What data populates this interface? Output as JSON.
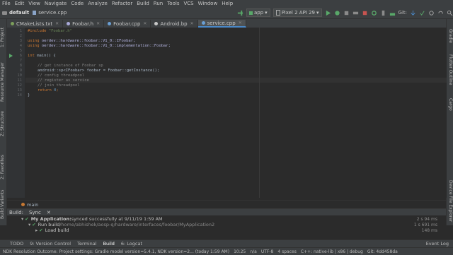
{
  "menu": [
    "File",
    "Edit",
    "View",
    "Navigate",
    "Code",
    "Analyze",
    "Refactor",
    "Build",
    "Run",
    "Tools",
    "VCS",
    "Window",
    "Help"
  ],
  "nav": {
    "project": "default",
    "file": "service.cpp",
    "run_config": "app",
    "device": "Pixel 2 API 29",
    "git_label": "Git:"
  },
  "tabs": [
    {
      "label": "CMakeLists.txt",
      "color": "#7b9e5a"
    },
    {
      "label": "Foobar.h",
      "color": "#a9a9d9"
    },
    {
      "label": "Foobar.cpp",
      "color": "#6a9fd4"
    },
    {
      "label": "Android.bp",
      "color": "#c8c8c8"
    },
    {
      "label": "service.cpp",
      "color": "#6a9fd4"
    }
  ],
  "left_tools": [
    "1: Project",
    "Resource Manager",
    "Z: Structure",
    "2: Favorites",
    "Build Variants"
  ],
  "right_tools": [
    "Gradle",
    "Flutter Outline",
    "Cargo",
    "Device File Explorer"
  ],
  "code": {
    "line_numbers": [
      "1",
      "2",
      "3",
      "4",
      "5",
      "6",
      "7",
      "8",
      "9",
      "10",
      "11",
      "12",
      "13",
      "14"
    ],
    "include_kw": "#include",
    "include_str": "\"Foobar.h\"",
    "using1": "using ",
    "using1_ns": "oerdev::hardware::foobar::V1_0::IFoobar;",
    "using2": "using ",
    "using2_ns": "oerdev::hardware::foobar::V1_0::implementation::Foobar;",
    "main_kw": "int",
    "main_rest": " main() {",
    "c1": "// get instance of Foobar sp",
    "l2": "android::sp<IFoobar> foobar = Foobar::getInstance();",
    "c2": "// config threadpool",
    "c3": "// register as service",
    "c4": "// join threadpool",
    "ret_kw": "return",
    "ret_num": " 0",
    "ret_end": ";",
    "close": "}"
  },
  "breadcrumb_bottom": "main",
  "build": {
    "header_build": "Build:",
    "header_sync": "Sync",
    "r1_bold": "My Application:",
    "r1_rest": " synced successfully at 9/11/19 1:59 AM",
    "r1_time": "2 s 94 ms",
    "r2_label": "Run build",
    "r2_path": " /home/abhishek/aosp-q/hardware/interfaces/foobar/MyApplication2",
    "r2_time": "1 s 691 ms",
    "r3_label": "Load build",
    "r3_time": "148 ms"
  },
  "toolstrip": [
    "TODO",
    "9: Version Control",
    "Terminal",
    "Build",
    "6: Logcat"
  ],
  "toolstrip_right": "Event Log",
  "status": {
    "msg": "NDK Resolution Outcome: Project settings: Gradle model version=5.4.1, NDK version=2... (today 1:59 AM)",
    "pos": "10:25",
    "na": "n/a",
    "enc": "UTF-8",
    "indent": "4 spaces",
    "ctx": "C++: native-lib | x86 | debug",
    "git": "Git: 4dd458da"
  }
}
